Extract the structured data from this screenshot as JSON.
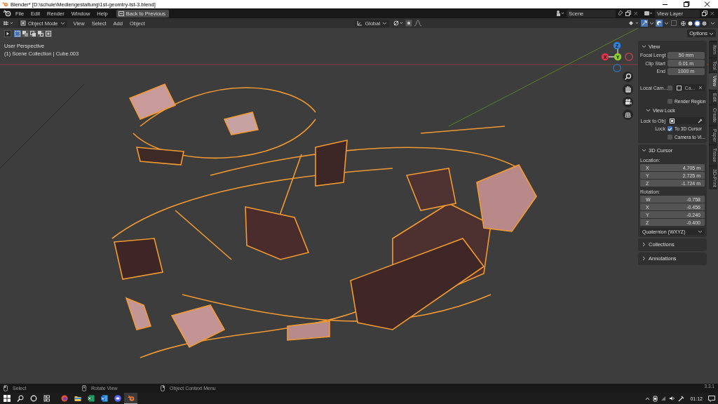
{
  "window": {
    "title": "Blender* [D:\\schule\\Mediengestaltung\\1st-geomtry-tst-3.blend]"
  },
  "topbar": {
    "menus": [
      "File",
      "Edit",
      "Render",
      "Window",
      "Help"
    ],
    "back_button": "Back to Previous",
    "scene": "Scene",
    "view_layer": "View Layer"
  },
  "header": {
    "mode": "Object Mode",
    "menus": [
      "View",
      "Select",
      "Add",
      "Object"
    ],
    "orientation": "Global",
    "shading": [
      {
        "selected": false
      },
      {
        "selected": false
      },
      {
        "selected": true
      },
      {
        "selected": false
      }
    ]
  },
  "select_modes": [
    {
      "selected": true
    },
    {
      "selected": false
    },
    {
      "selected": false
    },
    {
      "selected": false
    },
    {
      "selected": false
    }
  ],
  "viewport": {
    "perspective": "User Perspective",
    "collection": "(1) Scene Collection | Cube.003",
    "gizmo_axes": [
      "Z",
      "X",
      "Y"
    ]
  },
  "sidebar": {
    "options": "Options",
    "tabs": [
      {
        "label": "Item",
        "selected": false
      },
      {
        "label": "Tool",
        "selected": false
      },
      {
        "label": "View",
        "selected": true
      },
      {
        "label": "Edit",
        "selected": false
      },
      {
        "label": "Create",
        "selected": false
      },
      {
        "label": "Paper",
        "selected": false
      },
      {
        "label": "Tissue",
        "selected": false
      },
      {
        "label": "3D-Print",
        "selected": false
      }
    ],
    "panels": [
      {
        "title": "View",
        "expanded": true,
        "rows": [
          {
            "kind": "field",
            "label": "Focal Lengt",
            "value": "50 mm"
          },
          {
            "kind": "field",
            "label": "Clip Start",
            "value": "0.01 m"
          },
          {
            "kind": "field",
            "label": "End",
            "value": "1000 m"
          },
          {
            "kind": "camera",
            "label": "Local Cam...",
            "checked": false,
            "value": "Ca..."
          },
          {
            "kind": "checkbox",
            "label": "Render Region",
            "checked": false
          },
          {
            "kind": "subpanel",
            "title": "View Lock",
            "expanded": true
          },
          {
            "kind": "object",
            "label": "Lock to Obj"
          },
          {
            "kind": "checkbox",
            "prefix": "Lock",
            "label": "To 3D Cursor",
            "checked": true
          },
          {
            "kind": "checkbox",
            "label": "Camera to Vi...",
            "checked": false
          }
        ]
      },
      {
        "title": "3D Cursor",
        "expanded": true,
        "rows": [
          {
            "kind": "vector",
            "label": "Location:",
            "items": [
              {
                "axis": "X",
                "value": "4.705 m"
              },
              {
                "axis": "Y",
                "value": "2.725 m"
              },
              {
                "axis": "Z",
                "value": "-1.724 m"
              }
            ]
          },
          {
            "kind": "vector",
            "label": "Rotation:",
            "items": [
              {
                "axis": "W",
                "value": "-0.758"
              },
              {
                "axis": "X",
                "value": "-0.456"
              },
              {
                "axis": "Y",
                "value": "-0.240"
              },
              {
                "axis": "Z",
                "value": "-0.400"
              }
            ]
          },
          {
            "kind": "dropdown",
            "value": "Quaternion (WXYZ)"
          }
        ]
      },
      {
        "title": "Collections",
        "expanded": false
      },
      {
        "title": "Annotations",
        "expanded": false
      }
    ]
  },
  "status_bar": {
    "hints": [
      "Select",
      "Rotate View",
      "Object Context Menu"
    ],
    "version": "3.3.1"
  },
  "taskbar": {
    "apps": [
      {
        "kind": "browser",
        "selected": false
      },
      {
        "kind": "folder",
        "selected": false
      },
      {
        "kind": "spreadsheet",
        "selected": false
      },
      {
        "kind": "document",
        "selected": false
      },
      {
        "kind": "chat",
        "selected": false
      },
      {
        "kind": "blender",
        "selected": true
      }
    ],
    "time": "01:12"
  }
}
